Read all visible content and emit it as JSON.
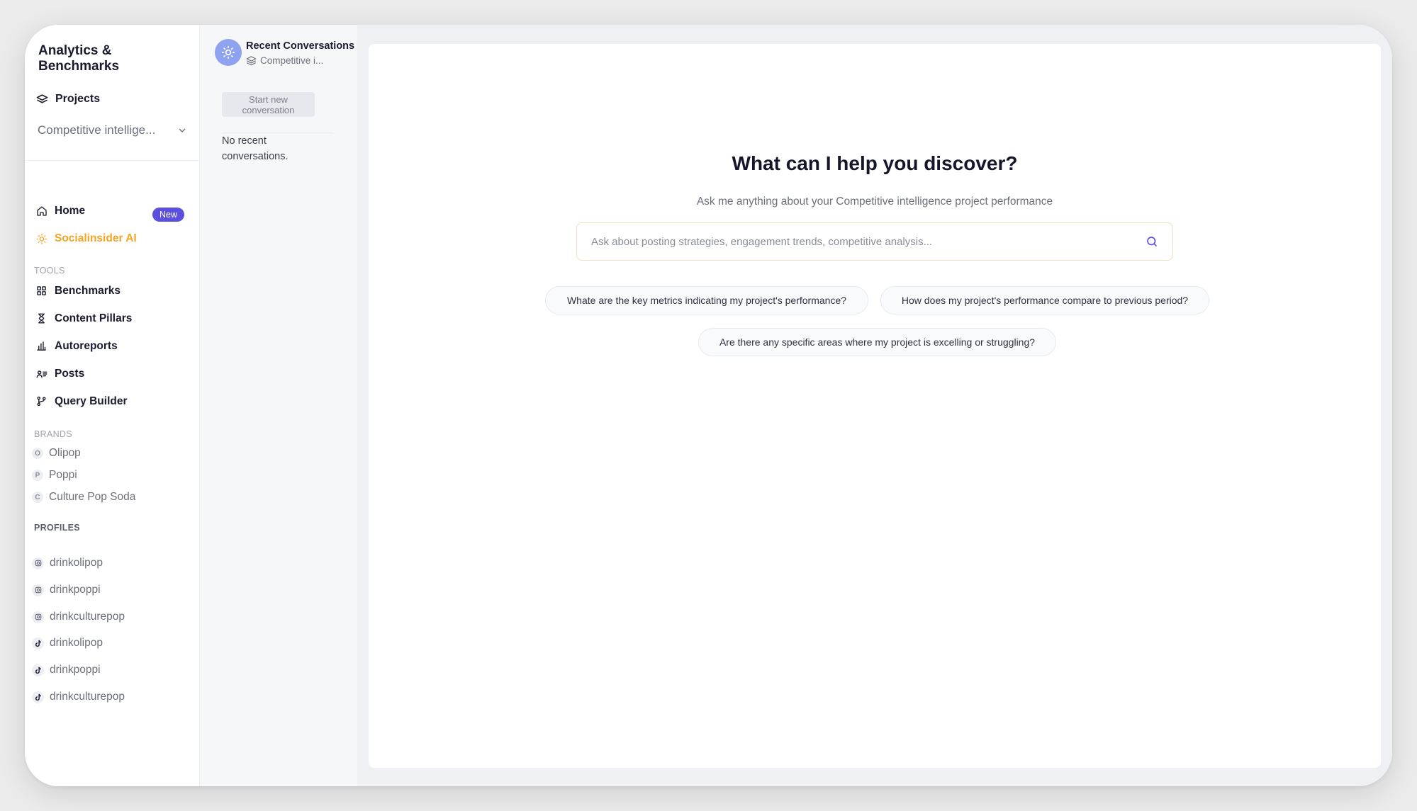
{
  "app": {
    "title": "Analytics & Benchmarks"
  },
  "projects": {
    "label": "Projects",
    "selected": "Competitive intellige..."
  },
  "nav": {
    "home": "Home",
    "ai": "Socialinsider AI",
    "ai_badge": "New"
  },
  "tools": {
    "label": "TOOLS",
    "items": [
      "Benchmarks",
      "Content Pillars",
      "Autoreports",
      "Posts",
      "Query Builder"
    ]
  },
  "brands": {
    "label": "BRANDS",
    "items": [
      {
        "letter": "O",
        "name": "Olipop"
      },
      {
        "letter": "P",
        "name": "Poppi"
      },
      {
        "letter": "C",
        "name": "Culture Pop Soda"
      }
    ]
  },
  "profiles": {
    "label": "PROFILES",
    "items": [
      {
        "network": "instagram-icon",
        "name": "drinkolipop"
      },
      {
        "network": "instagram-icon",
        "name": "drinkpoppi"
      },
      {
        "network": "instagram-icon",
        "name": "drinkculturepop"
      },
      {
        "network": "tiktok-icon",
        "name": "drinkolipop"
      },
      {
        "network": "tiktok-icon",
        "name": "drinkpoppi"
      },
      {
        "network": "tiktok-icon",
        "name": "drinkculturepop"
      }
    ]
  },
  "conversations": {
    "title": "Recent Conversations",
    "project": "Competitive i...",
    "new_button": "Start new conversation",
    "empty": "No recent conversations."
  },
  "main": {
    "title": "What can I help you discover?",
    "subtitle": "Ask me anything about your Competitive intelligence project performance",
    "search_placeholder": "Ask about posting strategies, engagement trends, competitive analysis...",
    "suggestions": [
      "Whate are the key metrics indicating my project's performance?",
      "How does my project's performance compare to previous period?",
      "Are there any specific areas where my project is excelling or struggling?"
    ]
  },
  "colors": {
    "accent": "#5b4fe0",
    "ai_orange": "#f5a524",
    "avatar": "#8ea3f0"
  }
}
